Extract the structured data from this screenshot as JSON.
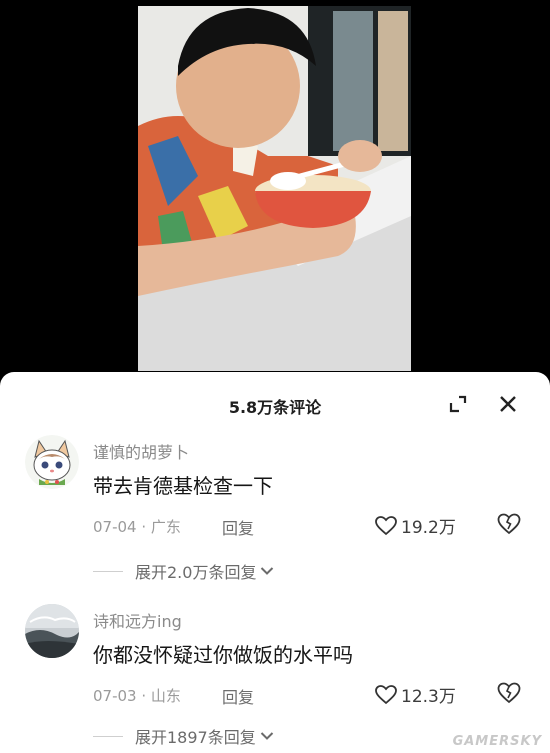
{
  "sheet": {
    "title": "5.8万条评论"
  },
  "comments": [
    {
      "username": "谨慎的胡萝卜",
      "text": "带去肯德基检查一下",
      "meta": "07-04 · 广东",
      "reply_label": "回复",
      "likes": "19.2万",
      "expand_label": "展开2.0万条回复"
    },
    {
      "username": "诗和远方ing",
      "text": "你都没怀疑过你做饭的水平吗",
      "meta": "07-03 · 山东",
      "reply_label": "回复",
      "likes": "12.3万",
      "expand_label": "展开1897条回复"
    }
  ],
  "watermark": "GAMERSKY"
}
